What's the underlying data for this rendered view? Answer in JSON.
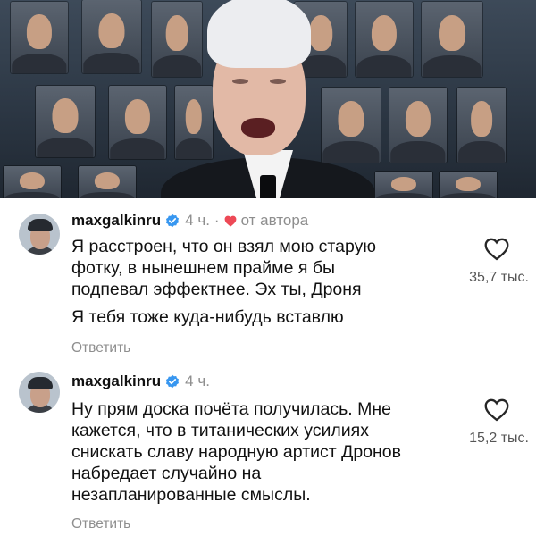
{
  "comments": [
    {
      "username": "maxgalkinru",
      "time": "4 ч.",
      "separator": "·",
      "author_label": "от автора",
      "text": "Я расстроен, что он взял мою старую\nфотку, в нынешнем прайме я бы\nподпевал эффектнее. Эх ты, Дроня",
      "text2": "Я тебя тоже куда-нибудь вставлю",
      "reply_label": "Ответить",
      "likes": "35,7 тыс."
    },
    {
      "username": "maxgalkinru",
      "time": "4 ч.",
      "text": "Ну прям доска почёта получилась. Мне\nкажется, что в титанических усилиях\nснискать славу народную артист Дронов\nнабредает случайно на\nнезапланированные смыслы.",
      "reply_label": "Ответить",
      "likes": "15,2 тыс."
    }
  ],
  "icons": {
    "verified": "verified-badge-icon",
    "author_heart": "heart-filled-icon",
    "like": "heart-outline-icon"
  },
  "colors": {
    "verified": "#3897f0",
    "author_heart": "#ed4956",
    "muted": "#8e8e8e"
  }
}
